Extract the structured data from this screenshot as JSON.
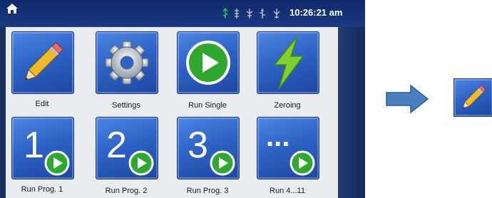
{
  "statusbar": {
    "home_icon": "home-icon",
    "status_icons": [
      "usb-icon",
      "usb-icon",
      "usb-icon",
      "usb-icon",
      "usb-icon"
    ],
    "time": "10:26:21 am"
  },
  "tiles": [
    {
      "id": "edit",
      "label": "Edit",
      "icon": "pencil-icon"
    },
    {
      "id": "settings",
      "label": "Settings",
      "icon": "gear-icon"
    },
    {
      "id": "run-single",
      "label": "Run Single",
      "icon": "play-icon"
    },
    {
      "id": "zeroing",
      "label": "Zeroing",
      "icon": "lightning-icon"
    },
    {
      "id": "run-prog-1",
      "label": "Run Prog. 1",
      "number": "1",
      "icon": "play-icon"
    },
    {
      "id": "run-prog-2",
      "label": "Run Prog. 2",
      "number": "2",
      "icon": "play-icon"
    },
    {
      "id": "run-prog-3",
      "label": "Run Prog. 3",
      "number": "3",
      "icon": "play-icon"
    },
    {
      "id": "run-4-11",
      "label": "Run 4...11",
      "number": "...",
      "icon": "play-icon"
    }
  ],
  "annotation": {
    "arrow_icon": "right-arrow-icon",
    "highlight_icon": "pencil-icon"
  },
  "colors": {
    "tile_blue": "#2d63c6",
    "statusbar": "#1a3a85",
    "play_green": "#2fa830",
    "arrow_blue": "#4a7fc0"
  }
}
